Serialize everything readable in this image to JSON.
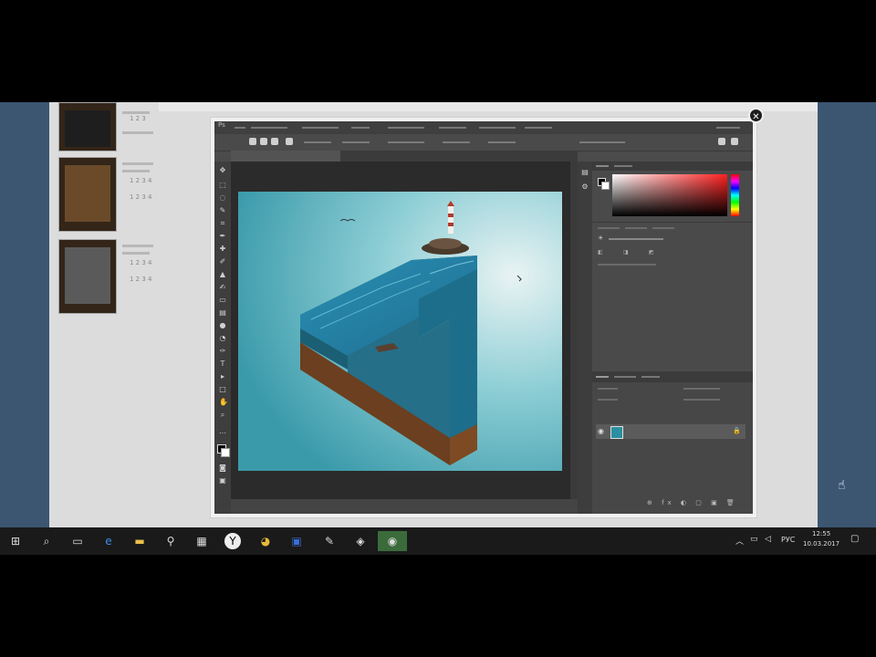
{
  "page": {
    "header_text": "",
    "products": [
      {
        "meta": [
          "1 2 3",
          "1 2 3 4 5"
        ]
      },
      {
        "meta": [
          "1 2 3 4",
          "1 2 3 4"
        ]
      },
      {
        "meta": [
          "1 2 3 4",
          "1 2 3 4"
        ]
      }
    ]
  },
  "photoshop": {
    "logo": "Ps",
    "menu": [
      "",
      "",
      "",
      "",
      "",
      "",
      "",
      "",
      ""
    ],
    "document_tab": "",
    "footer_text": "",
    "layer_name": ""
  },
  "window": {
    "close_glyph": "✕"
  },
  "taskbar": {
    "icons": [
      "windows-icon",
      "search-icon",
      "task-view-icon",
      "edge-icon",
      "file-explorer-icon",
      "pin-icon",
      "store-icon",
      "yandex-icon",
      "chrome-icon",
      "app-icon",
      "notepad-icon",
      "app-icon-2",
      "photoshop-icon"
    ],
    "lang": "РУС",
    "clock_time": "12:55",
    "clock_date": "10.03.2017"
  },
  "colors": {
    "ps_dark": "#3e3e3e",
    "ps_panel": "#4a4a4a",
    "artwork_teal": "#2a8fa0",
    "desktop_blue": "#3c5672"
  }
}
